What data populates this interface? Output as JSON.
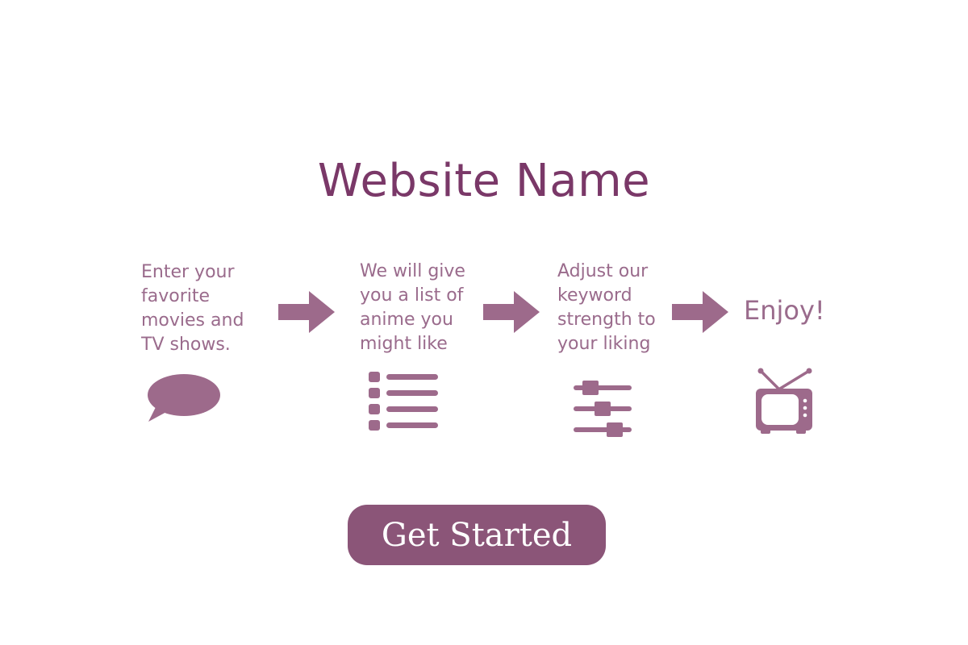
{
  "header": {
    "title": "Website Name"
  },
  "steps": [
    {
      "text": "Enter your favorite movies and TV shows.",
      "icon": "chat-bubble-icon"
    },
    {
      "text": "We will give you a list of anime you might like",
      "icon": "list-icon"
    },
    {
      "text": "Adjust our keyword strength to your liking",
      "icon": "sliders-icon"
    },
    {
      "text": "Enjoy!",
      "icon": "tv-icon"
    }
  ],
  "cta": {
    "label": "Get Started"
  },
  "colors": {
    "title": "#7a3868",
    "text": "#9a6b8c",
    "icon": "#9d6a8b",
    "button_bg": "#8b5578",
    "button_text": "#ffffff",
    "background": "#ffffff"
  }
}
